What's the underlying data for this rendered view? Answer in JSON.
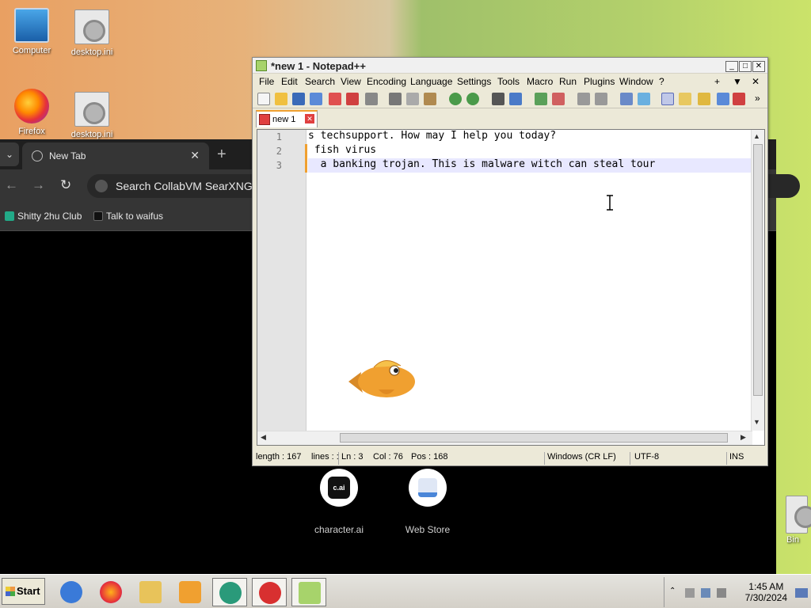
{
  "desktop": {
    "icons": [
      {
        "label": "Computer"
      },
      {
        "label": "desktop.ini"
      },
      {
        "label": "Firefox"
      },
      {
        "label": "desktop.ini"
      },
      {
        "label": "Bin"
      }
    ]
  },
  "browser": {
    "tab_title": "New Tab",
    "omnibox_text": "Search CollabVM SearXNG o",
    "bookmarks": [
      "Shitty 2hu Club",
      "Talk to waifus"
    ],
    "shortcuts": [
      {
        "label": "character.ai",
        "icon_text": "c.ai"
      },
      {
        "label": "Web Store"
      }
    ]
  },
  "notepad": {
    "title": "*new 1 - Notepad++",
    "menu": [
      "File",
      "Edit",
      "Search",
      "View",
      "Encoding",
      "Language",
      "Settings",
      "Tools",
      "Macro",
      "Run",
      "Plugins",
      "Window",
      "?"
    ],
    "menu_right": [
      "+",
      "▼",
      "✕"
    ],
    "tab_label": "new 1",
    "line_numbers": [
      "1",
      "2",
      "3"
    ],
    "lines": [
      "s techsupport. How may I help you today?",
      " fish virus",
      "  a banking trojan. This is malware witch can steal tour "
    ],
    "status": {
      "length": "length : 167",
      "lines": "lines : :",
      "ln": "Ln : 3",
      "col": "Col : 76",
      "pos": "Pos : 168",
      "eol": "Windows (CR LF)",
      "encoding": "UTF-8",
      "mode": "INS"
    }
  },
  "taskbar": {
    "start_label": "Start",
    "clock_time": "1:45 AM",
    "clock_date": "7/30/2024"
  }
}
